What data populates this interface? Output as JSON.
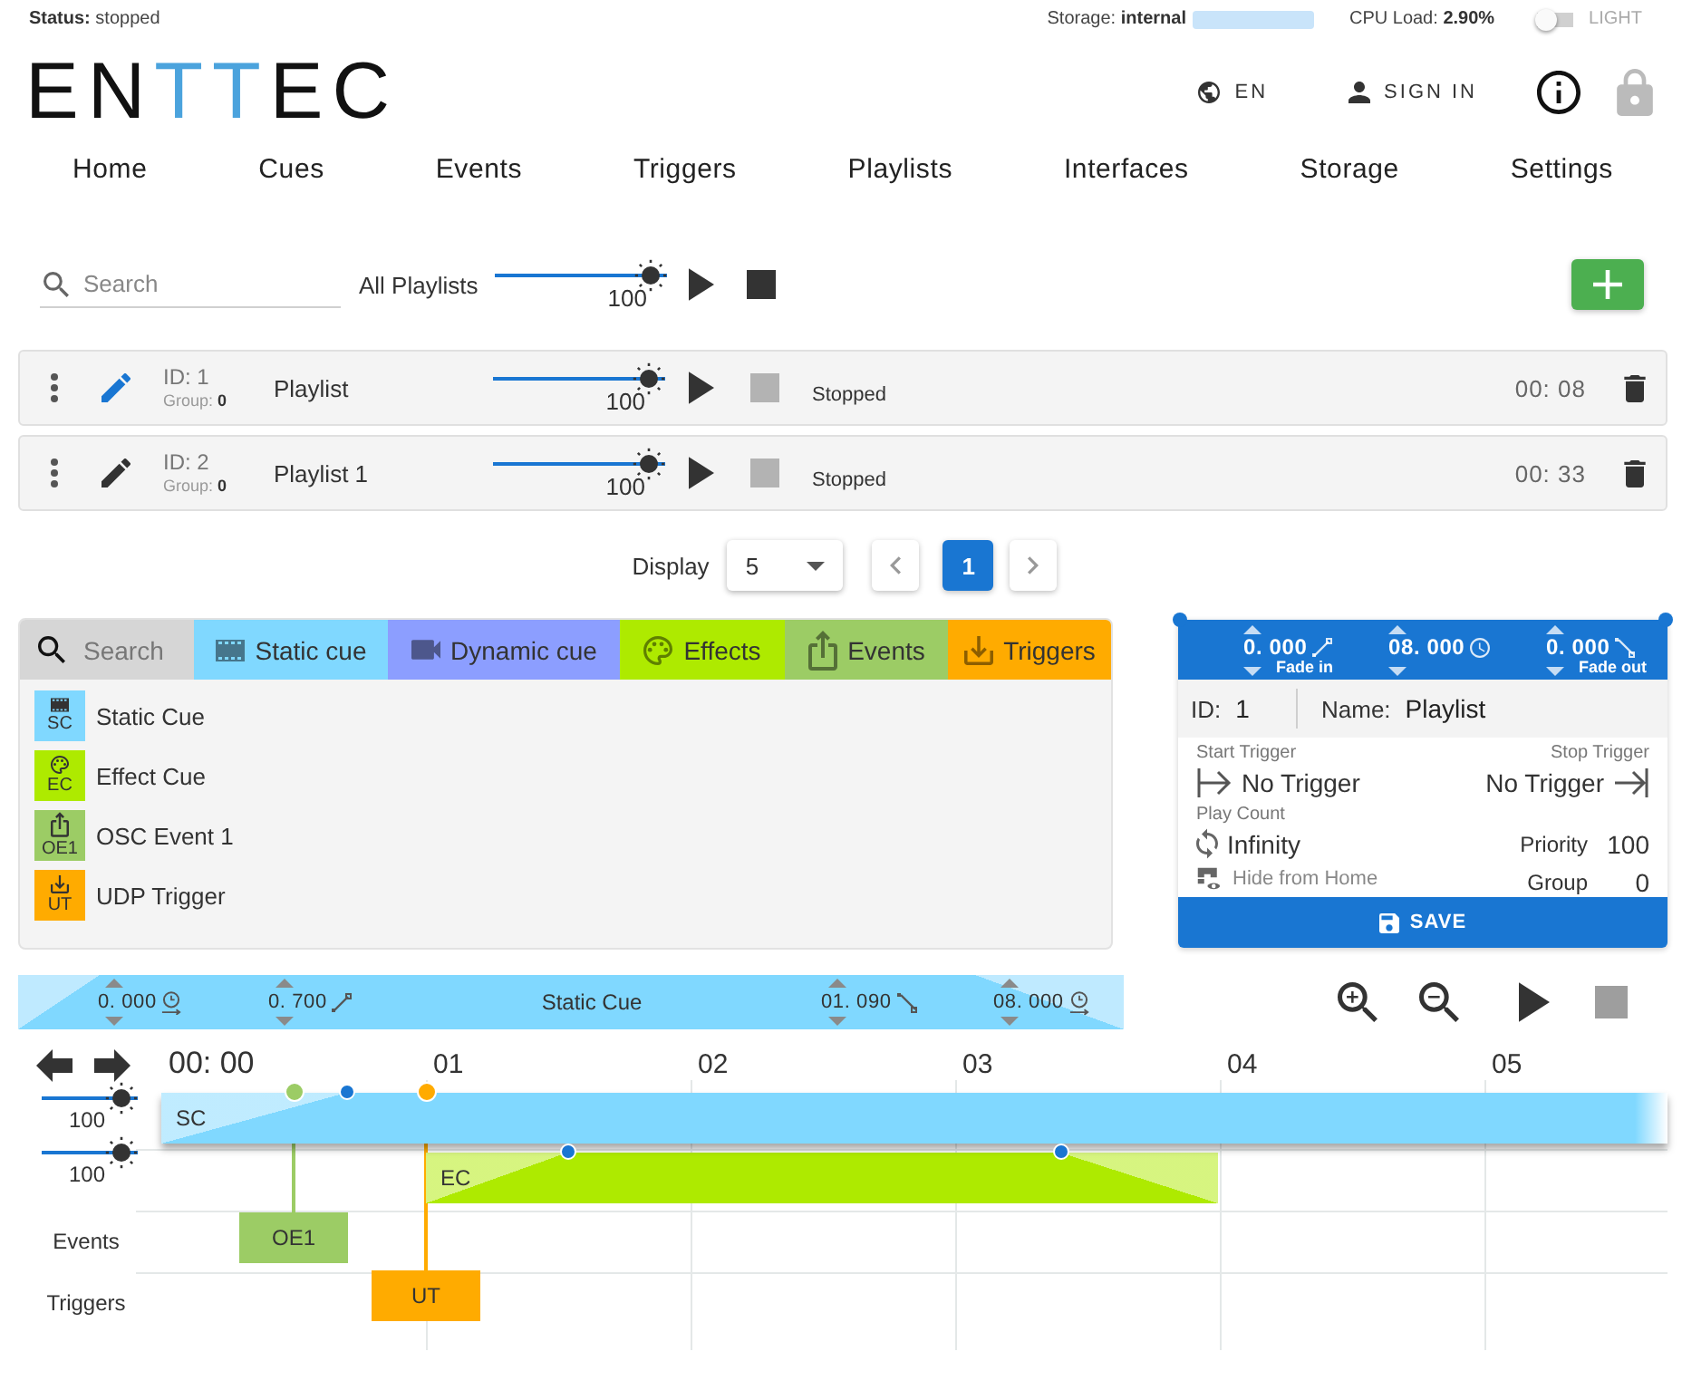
{
  "status_bar": {
    "status": "**Status:** stopped",
    "storage": "Storage: **internal**",
    "cpu": "CPU Load: **2.90%**",
    "theme_toggle": {
      "label": "LIGHT",
      "on": false
    }
  },
  "header": {
    "logo": "EN**TT**EC",
    "language": "EN",
    "sign_in": "SIGN IN"
  },
  "nav": [
    "Home",
    "Cues",
    "Events",
    "Triggers",
    "Playlists",
    "Interfaces",
    "Storage",
    "Settings"
  ],
  "playlists": {
    "search": {
      "placeholder": "Search"
    },
    "all_label": "All Playlists",
    "master": {
      "level": 1,
      "reading": "100"
    },
    "rows": [
      {
        "selected": true,
        "id": "ID: 1",
        "group": "Group: **0**",
        "name": "Playlist",
        "level": 1,
        "reading": "100",
        "status": "Stopped",
        "duration": "00: 08"
      },
      {
        "selected": false,
        "id": "ID: 2",
        "group": "Group: **0**",
        "name": "Playlist 1",
        "level": 1,
        "reading": "100",
        "status": "Stopped",
        "duration": "00: 33"
      }
    ]
  },
  "pagination": {
    "label": "Display",
    "page_size": "5",
    "pages": [
      {
        "label": "1",
        "selected": true
      }
    ]
  },
  "cue_library": {
    "search": {
      "placeholder": "Search"
    },
    "categories": [
      {
        "kind": "static",
        "label": "Static cue",
        "color": "#80d8ff"
      },
      {
        "kind": "dynamic",
        "label": "Dynamic cue",
        "color": "#8c9eff"
      },
      {
        "kind": "effect",
        "label": "Effects",
        "color": "#aeea00"
      },
      {
        "kind": "event",
        "label": "Events",
        "color": "#9ccc65"
      },
      {
        "kind": "trigger",
        "label": "Triggers",
        "color": "#ffab00"
      }
    ],
    "items": [
      {
        "kind": "static",
        "abbr": "SC",
        "label": "Static Cue",
        "color": "#80d8ff"
      },
      {
        "kind": "effect",
        "abbr": "EC",
        "label": "Effect Cue",
        "color": "#aeea00"
      },
      {
        "kind": "event",
        "abbr": "OE1",
        "label": "OSC Event 1",
        "color": "#9ccc65"
      },
      {
        "kind": "trigger",
        "abbr": "UT",
        "label": "UDP Trigger",
        "color": "#ffab00"
      }
    ]
  },
  "playlist_editor": {
    "fades": [
      {
        "kind": "fade_in",
        "value": "0. 000",
        "label": "Fade in"
      },
      {
        "kind": "duration",
        "value": "08. 000"
      },
      {
        "kind": "fade_out",
        "value": "0. 000",
        "label": "Fade out"
      }
    ],
    "id_label": "ID:",
    "id": "1",
    "name_label": "Name:",
    "name": "Playlist",
    "start_trigger": {
      "label": "Start Trigger",
      "value": "No Trigger"
    },
    "stop_trigger": {
      "label": "Stop Trigger",
      "value": "No Trigger"
    },
    "play_count": {
      "label": "Play Count",
      "value": "Infinity"
    },
    "hide_from_home": "Hide from Home",
    "priority": {
      "label": "Priority",
      "value": "100"
    },
    "group": {
      "label": "Group",
      "value": "0"
    },
    "save": "SAVE"
  },
  "cue_editor": {
    "fields": [
      {
        "kind": "delay",
        "value": "0. 000"
      },
      {
        "kind": "fade_in",
        "value": "0. 700"
      },
      {
        "kind": "title",
        "value": "Static Cue"
      },
      {
        "kind": "fade_out",
        "value": "01. 090"
      },
      {
        "kind": "hold",
        "value": "08. 000"
      }
    ]
  },
  "timeline": {
    "time_labels": [
      "00: 00",
      "01",
      "02",
      "03",
      "04",
      "05"
    ],
    "lanes": [
      {
        "level": 1,
        "reading": "100"
      },
      {
        "level": 1,
        "reading": "100"
      }
    ],
    "row_labels": [
      "Events",
      "Triggers"
    ],
    "clips": [
      {
        "kind": "cue",
        "label": "SC",
        "color": "#80d8ff",
        "selected": true
      },
      {
        "kind": "cue",
        "label": "EC",
        "color": "#aeea00",
        "selected": false
      },
      {
        "kind": "event",
        "label": "OE1",
        "color": "#9ccc65",
        "selected": false
      },
      {
        "kind": "trigger",
        "label": "UT",
        "color": "#ffab00",
        "selected": false
      }
    ]
  }
}
